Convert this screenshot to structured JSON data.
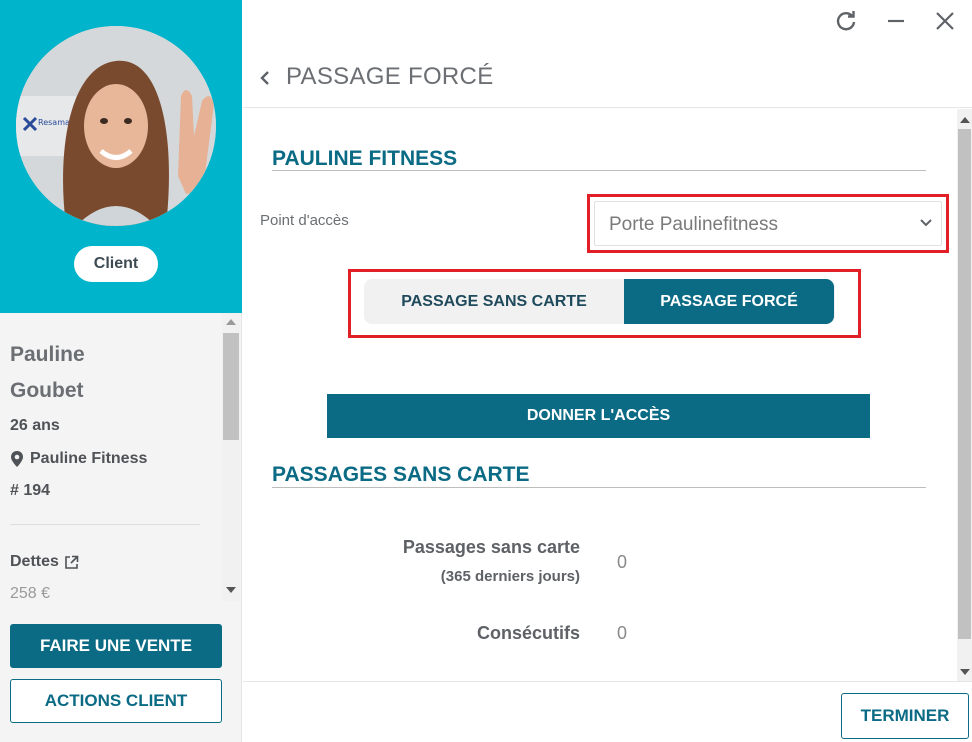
{
  "sidebar": {
    "badge": "Client",
    "first_name": "Pauline",
    "last_name": "Goubet",
    "age": "26 ans",
    "club": "Pauline Fitness",
    "member_number": "# 194",
    "debts_label": "Dettes",
    "debts_value": "258 €",
    "primary_button": "FAIRE UNE VENTE",
    "secondary_button": "ACTIONS CLIENT",
    "avatar_logo_text": "Resama"
  },
  "window": {
    "controls": [
      "refresh-icon",
      "minimize-icon",
      "close-icon"
    ]
  },
  "header": {
    "title": "PASSAGE FORCÉ"
  },
  "main": {
    "section1_title": "PAULINE FITNESS",
    "access_point_label": "Point d'accès",
    "access_point_value": "Porte Paulinefitness",
    "toggle": {
      "options": [
        "PASSAGE SANS CARTE",
        "PASSAGE FORCÉ"
      ],
      "selected": "PASSAGE FORCÉ"
    },
    "grant_button": "DONNER L'ACCÈS",
    "section2_title": "PASSAGES SANS CARTE",
    "stats": {
      "label1": "Passages sans carte",
      "label1_sub": "(365 derniers jours)",
      "value1": "0",
      "label2": "Consécutifs",
      "value2": "0"
    }
  },
  "footer": {
    "finish_button": "TERMINER"
  },
  "colors": {
    "sidebar_accent": "#00b4cb",
    "primary": "#0b6a84",
    "highlight_box": "#e01f26"
  }
}
